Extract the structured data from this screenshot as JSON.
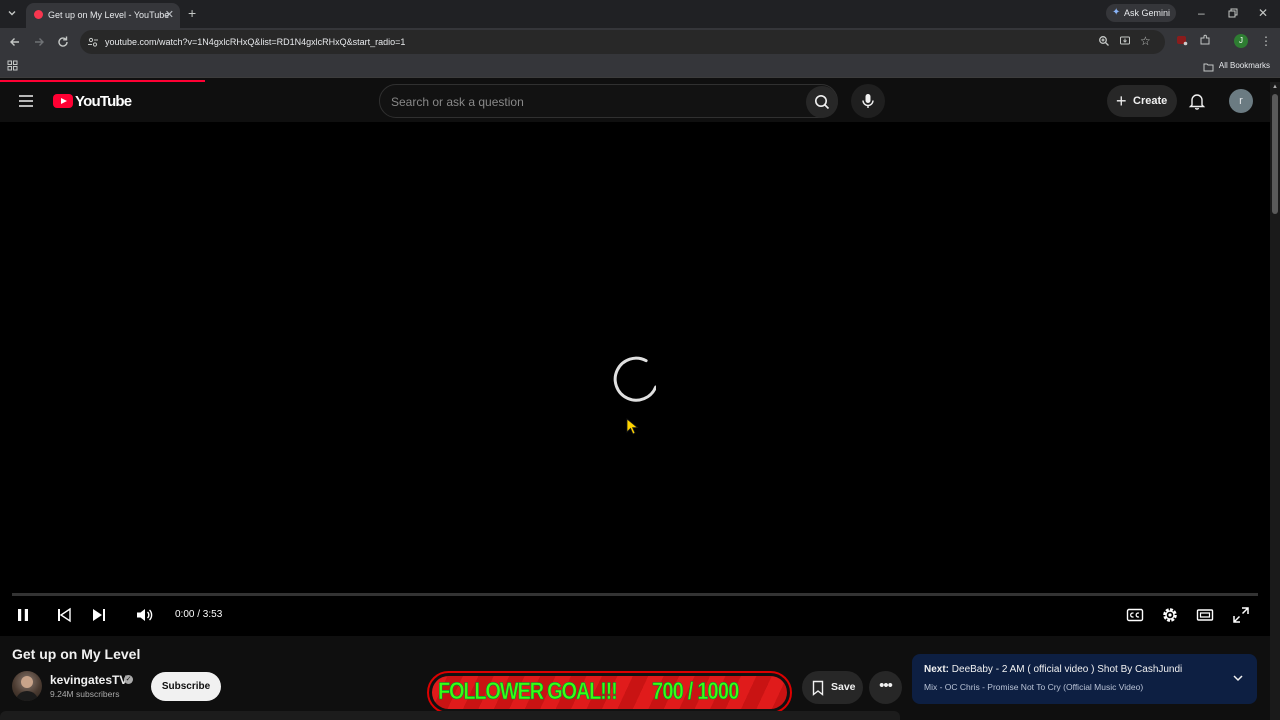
{
  "browser": {
    "tab_title": "Get up on My Level - YouTube",
    "ask_gemini": "Ask Gemini",
    "url": "youtube.com/watch?v=1N4gxlcRHxQ&list=RD1N4gxlcRHxQ&start_radio=1",
    "all_bookmarks": "All Bookmarks",
    "profile_initial": "J"
  },
  "header": {
    "logo_text": "YouTube",
    "search_placeholder": "Search or ask a question",
    "create_label": "Create",
    "avatar_initial": "r"
  },
  "player": {
    "time": "0:00 / 3:53",
    "progress": 0.0,
    "state": "loading"
  },
  "video": {
    "title": "Get up on My Level",
    "channel": "kevingatesTV",
    "subscribers": "9.24M subscribers",
    "subscribe_label": "Subscribe",
    "save_label": "Save"
  },
  "overlay": {
    "goal_label": "FOLLOWER GOAL!!!",
    "goal_count": "700 / 1000"
  },
  "next": {
    "prefix": "Next:",
    "title": "DeeBaby - 2 AM ( official video ) Shot By CashJundi",
    "subtitle": "Mix - OC Chris - Promise Not To Cry (Official Music Video)"
  },
  "colors": {
    "brand_red": "#ff0033",
    "goal_green": "#39ff14",
    "next_card_bg": "#0d1f42"
  }
}
